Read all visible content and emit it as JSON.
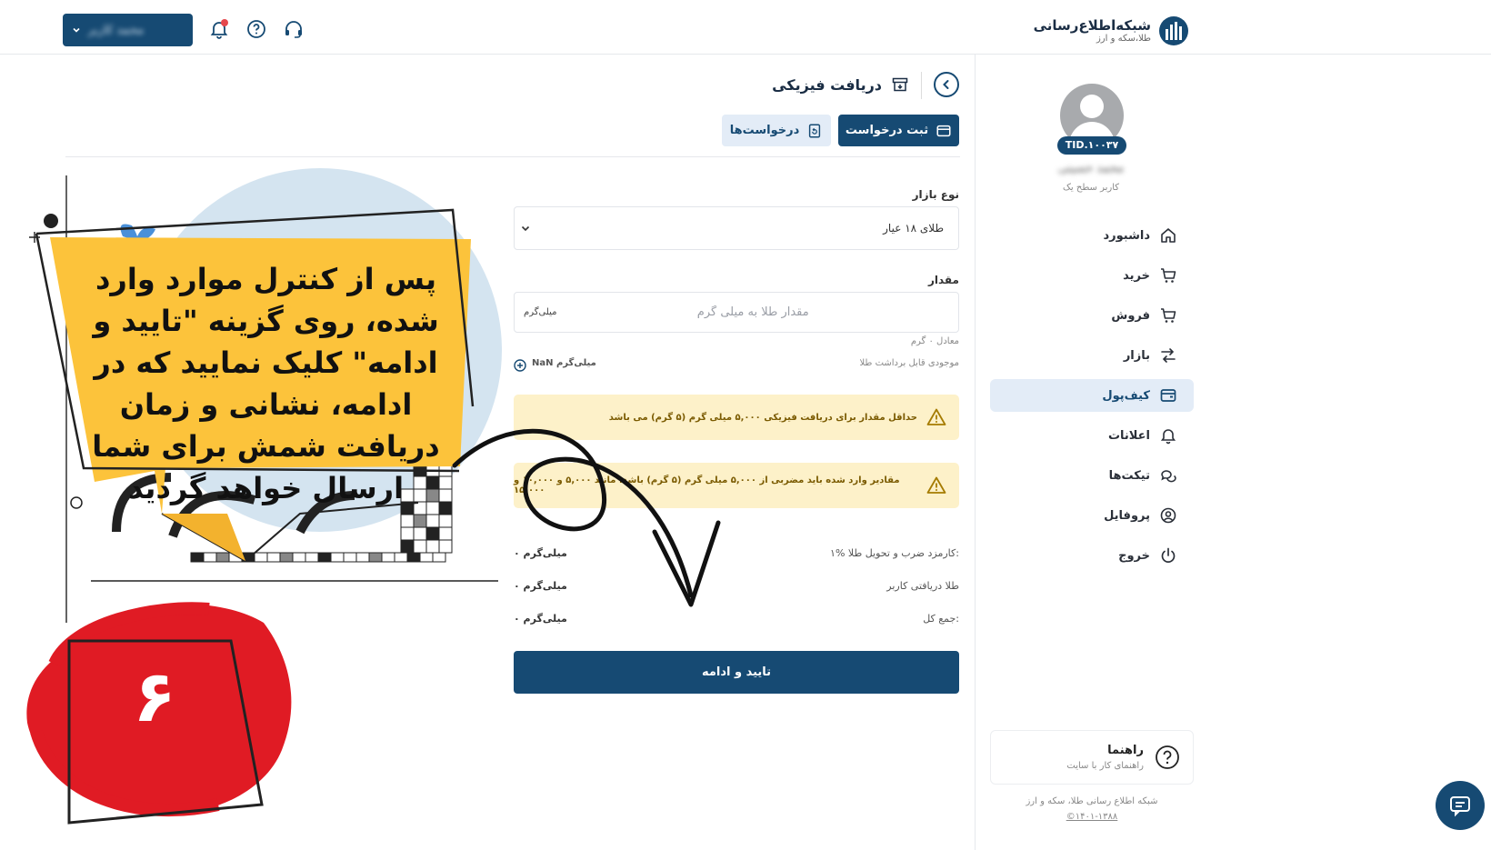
{
  "header": {
    "logo_title": "شبکه‌اطلاع‌رسانی",
    "logo_subtitle": "طلا،سکه و ارز",
    "user_menu_label": "محمد کاربر"
  },
  "sidebar": {
    "user_id": "TID.۱۰۰۳۷",
    "user_name": "محمد حسینی",
    "user_level": "کاربر سطح یک",
    "items": [
      {
        "label": "داشبورد",
        "icon": "home-icon"
      },
      {
        "label": "خرید",
        "icon": "cart-icon"
      },
      {
        "label": "فروش",
        "icon": "cart-icon"
      },
      {
        "label": "بازار",
        "icon": "exchange-icon"
      },
      {
        "label": "کیف‌پول",
        "icon": "wallet-icon",
        "active": true
      },
      {
        "label": "اعلانات",
        "icon": "bell-icon"
      },
      {
        "label": "تیکت‌ها",
        "icon": "chat-bubbles-icon"
      },
      {
        "label": "پروفایل",
        "icon": "user-circle-icon"
      },
      {
        "label": "خروج",
        "icon": "power-icon"
      }
    ],
    "help_title": "راهنما",
    "help_subtitle": "راهنمای کار با سایت",
    "footer_line1": "شبکه اطلاع رسانی طلا، سکه و ارز",
    "footer_line2": "©۱۴۰۱-۱۳۸۸"
  },
  "page": {
    "title": "دریافت فیزیکی",
    "tabs": [
      {
        "label": "ثبت درخواست",
        "active": true
      },
      {
        "label": "درخواست‌ها",
        "active": false
      }
    ]
  },
  "form": {
    "market_label": "نوع بازار",
    "market_value": "طلای ۱۸ عیار",
    "amount_label": "مقدار",
    "amount_placeholder": "مقدار طلا به میلی گرم",
    "amount_unit": "میلی‌گرم",
    "equivalent": "معادل ۰ گرم",
    "balance_label": "موجودی قابل برداشت طلا",
    "balance_value": "NaN میلی‌گرم",
    "alert1": "حداقل مقدار برای دریافت فیزیکی ۵,۰۰۰ میلی گرم (۵ گرم) می باشد",
    "alert2": "مقادیر وارد شده باید مضربی از ۵,۰۰۰ میلی گرم (۵ گرم) باشد، مانند ۵,۰۰۰ و ۱۰,۰۰۰ و ۱۵,۰۰۰",
    "summary": [
      {
        "label": "۱% کارمزد ضرب و تحویل طلا:",
        "value": "۰ میلی‌گرم"
      },
      {
        "label": "طلا دریافتی کاربر",
        "value": "۰ میلی‌گرم"
      },
      {
        "label": "جمع کل:",
        "value": "۰ میلی‌گرم"
      }
    ],
    "confirm_label": "تایید و ادامه"
  },
  "overlay": {
    "note": "پس از کنترل موارد وارد شده، روی گزینه \"تایید و ادامه\" کلیک نمایید که در ادامه، نشانی و زمان دریافت شمش برای شما ارسال خواهد گردید",
    "step_number": "۶"
  },
  "colors": {
    "primary": "#164a73",
    "active_bg": "#e3ecf7",
    "alert_bg": "#fdf1c9",
    "note_yellow": "#fcc33b",
    "step_red": "#e01b24"
  }
}
